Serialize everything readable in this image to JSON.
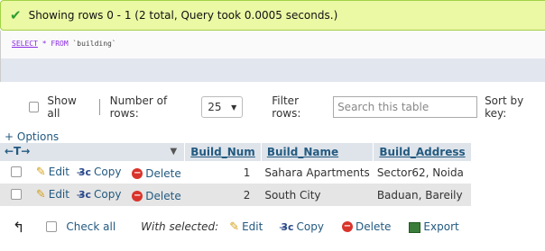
{
  "message": {
    "icon": "check-icon",
    "text": "Showing rows 0 - 1 (2 total, Query took 0.0005 seconds.)"
  },
  "sql": {
    "select": "SELECT",
    "star": "*",
    "from": "FROM",
    "table": "`building`"
  },
  "nav": {
    "show_all": "Show all",
    "num_rows_label": "Number of rows:",
    "num_rows_value": "25",
    "filter_label": "Filter rows:",
    "filter_placeholder": "Search this table",
    "sort_label": "Sort by key:"
  },
  "options_link": "+ Options",
  "table": {
    "columns": [
      "Build_Num",
      "Build_Name",
      "Build_Address"
    ],
    "rows": [
      {
        "num": "1",
        "name": "Sahara Apartments",
        "address": "Sector62, Noida"
      },
      {
        "num": "2",
        "name": "South City",
        "address": "Baduan, Bareily"
      }
    ],
    "actions": {
      "edit": "Edit",
      "copy": "Copy",
      "delete": "Delete"
    }
  },
  "bottom": {
    "check_all": "Check all",
    "with_selected": "With selected:",
    "edit": "Edit",
    "copy": "Copy",
    "delete": "Delete",
    "export": "Export"
  }
}
